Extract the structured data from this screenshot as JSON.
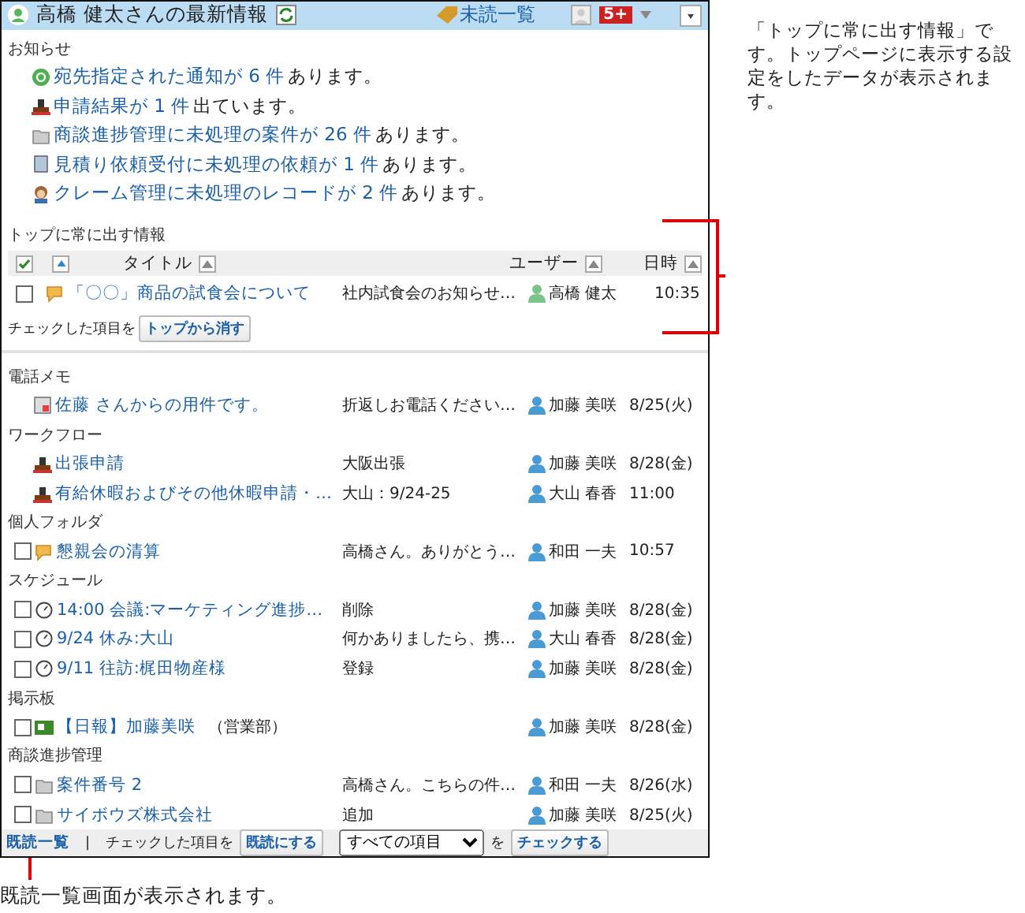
{
  "header": {
    "title": "高橋 健太さんの最新情報",
    "unread_link": "未読一覧",
    "badge": "5+"
  },
  "notices_title": "お知らせ",
  "notices": [
    {
      "kind": "at",
      "link": "宛先指定された通知が **6 件**",
      "rest": "あります。"
    },
    {
      "kind": "workflow",
      "link": "申請結果が **1 件**",
      "rest": "出ています。"
    },
    {
      "kind": "folder",
      "link": "商談進捗管理に未処理の案件が **26 件**",
      "rest": "あります。"
    },
    {
      "kind": "sheet",
      "link": "見積り依頼受付に未処理の依頼が **1 件**",
      "rest": "あります。"
    },
    {
      "kind": "person",
      "link": "クレーム管理に未処理のレコードが **2 件**",
      "rest": "あります。"
    }
  ],
  "top": {
    "title": "トップに常に出す情報",
    "columns": [
      "タイトル",
      "ユーザー",
      "日時"
    ],
    "rows": [
      {
        "kind": "message",
        "checked": false,
        "title": "「〇〇」商品の試食会について",
        "summary": "社内試食会のお知らせ…",
        "user": "高橋 健太",
        "date": "10:35"
      }
    ],
    "action_label": "チェックした項目を",
    "action_button": "トップから消す"
  },
  "sections": [
    {
      "title": "電話メモ",
      "rows": [
        {
          "kind": "memo",
          "title": "**佐藤** さんからの用件です。",
          "summary": "折返しお電話ください…",
          "user": "加藤 美咲",
          "date": "8/25(火)"
        }
      ]
    },
    {
      "title": "ワークフロー",
      "rows": [
        {
          "kind": "workflow",
          "title": "出張申請",
          "summary": "大阪出張",
          "user": "加藤 美咲",
          "date": "8/28(金)"
        },
        {
          "kind": "workflow",
          "title": "有給休暇およびその他休暇申請・…",
          "summary": "大山：9/24-25",
          "user": "大山 春香",
          "date": "11:00"
        }
      ]
    },
    {
      "title": "個人フォルダ",
      "rows": [
        {
          "kind": "message",
          "checked": false,
          "title": "懇親会の清算",
          "summary": "高橋さん。ありがとう…",
          "user": "和田 一夫",
          "date": "10:57"
        }
      ]
    },
    {
      "title": "スケジュール",
      "rows": [
        {
          "kind": "clock",
          "checked": false,
          "title": "14:00 会議:マーケティング進捗…",
          "summary": "削除",
          "user": "加藤 美咲",
          "date": "8/28(金)"
        },
        {
          "kind": "clock",
          "checked": false,
          "title": "9/24 休み:大山",
          "summary": "何かありましたら、携…",
          "user": "大山 春香",
          "date": "8/28(金)"
        },
        {
          "kind": "clock",
          "checked": false,
          "title": "9/11 往訪:梶田物産様",
          "summary": "登録",
          "user": "加藤 美咲",
          "date": "8/28(金)"
        }
      ]
    },
    {
      "title": "掲示板",
      "rows": [
        {
          "kind": "board",
          "checked": false,
          "title": "【日報】加藤美咲",
          "note": "（営業部）",
          "user": "加藤 美咲",
          "date": "8/28(金)"
        }
      ]
    },
    {
      "title": "商談進捗管理",
      "rows": [
        {
          "kind": "folder",
          "checked": false,
          "title": "案件番号 2",
          "summary": "高橋さん。こちらの件…",
          "user": "和田 一夫",
          "date": "8/26(水)"
        },
        {
          "kind": "folder",
          "checked": false,
          "title": "サイボウズ株式会社",
          "summary": "追加",
          "user": "加藤 美咲",
          "date": "8/25(火)"
        }
      ]
    }
  ],
  "footer": {
    "read_link": "既読一覧",
    "separator": "|",
    "label": "チェックした項目を",
    "read_button": "既読にする",
    "select_value": "すべての項目",
    "suffix": "を",
    "check_button": "チェックする"
  },
  "annotations": {
    "right": "「トップに常に出す情報」です。トップページに表示する設定をしたデータが表示されます。",
    "bottom": "既読一覧画面が表示されます。"
  }
}
